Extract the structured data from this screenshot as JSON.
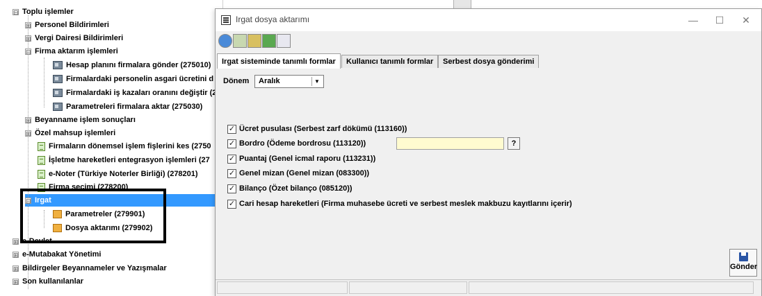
{
  "tree": {
    "items": [
      {
        "label": "Toplu işlemler",
        "expander": "⊟"
      },
      {
        "label": "Personel Bildirimleri",
        "expander": "⊞"
      },
      {
        "label": "Vergi Dairesi Bildirimleri",
        "expander": "⊞"
      },
      {
        "label": "Firma aktarım işlemleri",
        "expander": "⊟"
      },
      {
        "label": "Hesap planını firmalara gönder (275010)"
      },
      {
        "label": "Firmalardaki personelin asgari ücretini d"
      },
      {
        "label": "Firmalardaki iş kazaları oranını değiştir (2"
      },
      {
        "label": "Parametreleri firmalara aktar (275030)"
      },
      {
        "label": "Beyanname işlem sonuçları",
        "expander": "⊞"
      },
      {
        "label": "Özel mahsup işlemleri",
        "expander": "⊞"
      },
      {
        "label": "Firmaların dönemsel işlem fişlerini kes (2750"
      },
      {
        "label": "İşletme hareketleri entegrasyon işlemleri (27"
      },
      {
        "label": "e-Noter (Türkiye Noterler Birliği) (278201)"
      },
      {
        "label": "Firma seçimi (278200)"
      },
      {
        "label": "Irgat",
        "expander": "⊟"
      },
      {
        "label": "Parametreler (279901)"
      },
      {
        "label": "Dosya aktarımı (279902)"
      },
      {
        "label": "e-Devlet",
        "expander": "⊞"
      },
      {
        "label": "e-Mutabakat Yönetimi",
        "expander": "⊞"
      },
      {
        "label": "Bildirgeler Beyannameler ve Yazışmalar",
        "expander": "⊞"
      },
      {
        "label": "Son kullanılanlar",
        "expander": "⊞"
      }
    ]
  },
  "dialog": {
    "title": "Irgat dosya aktarımı",
    "window_buttons": {
      "minimize": "—",
      "maximize": "☐",
      "close": "✕"
    },
    "tabs": [
      "Irgat sisteminde tanımlı formlar",
      "Kullanıcı tanımlı formlar",
      "Serbest dosya gönderimi"
    ],
    "donem": {
      "label": "Dönem",
      "value": "Aralık",
      "arrow": "▼"
    },
    "checkboxes": [
      {
        "label": "Ücret pusulası (Serbest zarf dökümü (113160))",
        "checked": true
      },
      {
        "label": "Bordro (Ödeme bordrosu (113120))",
        "checked": true
      },
      {
        "label": "Puantaj (Genel icmal raporu (113231))",
        "checked": true
      },
      {
        "label": "Genel mizan (Genel mizan (083300))",
        "checked": true
      },
      {
        "label": "Bilanço (Özet bilanço (085120))",
        "checked": true
      },
      {
        "label": "Cari hesap hareketleri (Firma muhasebe ücreti ve serbest meslek makbuzu kayıtlarını içerir)",
        "checked": true
      }
    ],
    "check_mark": "✓",
    "help_label": "?",
    "send_label": "Gönder"
  },
  "colors": {
    "selection": "#3399ff",
    "send_icon": "#2a55a5",
    "input_bg": "#fffbd0"
  }
}
